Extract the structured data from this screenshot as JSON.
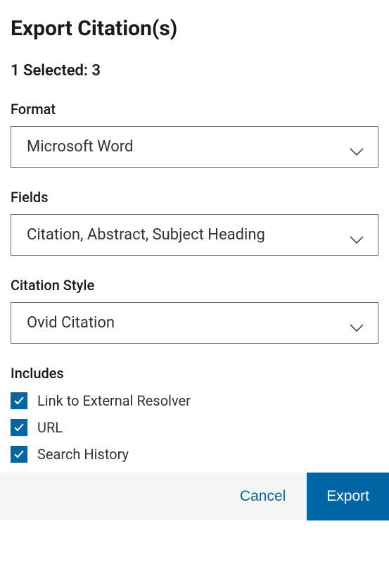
{
  "title": "Export Citation(s)",
  "selected_text": "1 Selected: 3",
  "format": {
    "label": "Format",
    "value": "Microsoft Word"
  },
  "fields": {
    "label": "Fields",
    "value": "Citation, Abstract, Subject Heading"
  },
  "citation_style": {
    "label": "Citation Style",
    "value": "Ovid Citation"
  },
  "includes": {
    "label": "Includes",
    "items": [
      {
        "label": "Link to External Resolver",
        "checked": true
      },
      {
        "label": "URL",
        "checked": true
      },
      {
        "label": "Search History",
        "checked": true
      }
    ]
  },
  "buttons": {
    "cancel": "Cancel",
    "export": "Export"
  }
}
